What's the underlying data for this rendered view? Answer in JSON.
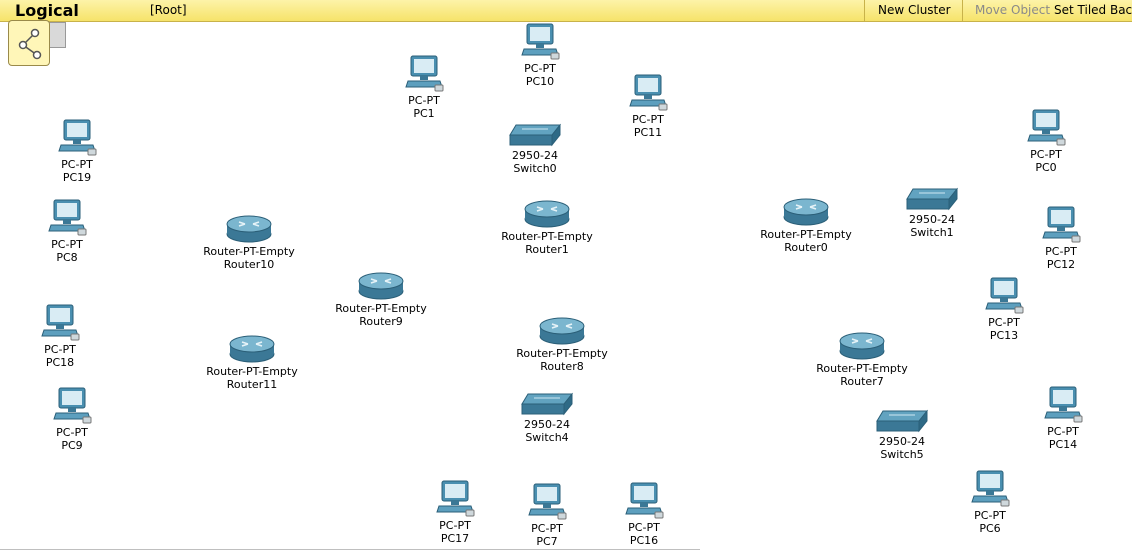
{
  "toolbar": {
    "mode_title": "Logical",
    "breadcrumb": "[Root]",
    "new_cluster": "New Cluster",
    "move_object": "Move Object",
    "set_tiled": "Set Tiled Back"
  },
  "colors": {
    "toolbar": "#f6e36a",
    "device": "#3d8aa8"
  },
  "devices": {
    "pc10": {
      "model": "PC-PT",
      "name": "PC10"
    },
    "pc1": {
      "model": "PC-PT",
      "name": "PC1"
    },
    "pc11": {
      "model": "PC-PT",
      "name": "PC11"
    },
    "pc19": {
      "model": "PC-PT",
      "name": "PC19"
    },
    "pc0": {
      "model": "PC-PT",
      "name": "PC0"
    },
    "pc8": {
      "model": "PC-PT",
      "name": "PC8"
    },
    "pc12": {
      "model": "PC-PT",
      "name": "PC12"
    },
    "pc13": {
      "model": "PC-PT",
      "name": "PC13"
    },
    "pc18": {
      "model": "PC-PT",
      "name": "PC18"
    },
    "pc9": {
      "model": "PC-PT",
      "name": "PC9"
    },
    "pc14": {
      "model": "PC-PT",
      "name": "PC14"
    },
    "pc17": {
      "model": "PC-PT",
      "name": "PC17"
    },
    "pc7": {
      "model": "PC-PT",
      "name": "PC7"
    },
    "pc16": {
      "model": "PC-PT",
      "name": "PC16"
    },
    "pc6": {
      "model": "PC-PT",
      "name": "PC6"
    },
    "switch0": {
      "model": "2950-24",
      "name": "Switch0"
    },
    "switch1": {
      "model": "2950-24",
      "name": "Switch1"
    },
    "switch4": {
      "model": "2950-24",
      "name": "Switch4"
    },
    "switch5": {
      "model": "2950-24",
      "name": "Switch5"
    },
    "router1": {
      "model": "Router-PT-Empty",
      "name": "Router1"
    },
    "router0": {
      "model": "Router-PT-Empty",
      "name": "Router0"
    },
    "router10": {
      "model": "Router-PT-Empty",
      "name": "Router10"
    },
    "router9": {
      "model": "Router-PT-Empty",
      "name": "Router9"
    },
    "router8": {
      "model": "Router-PT-Empty",
      "name": "Router8"
    },
    "router11": {
      "model": "Router-PT-Empty",
      "name": "Router11"
    },
    "router7": {
      "model": "Router-PT-Empty",
      "name": "Router7"
    }
  }
}
